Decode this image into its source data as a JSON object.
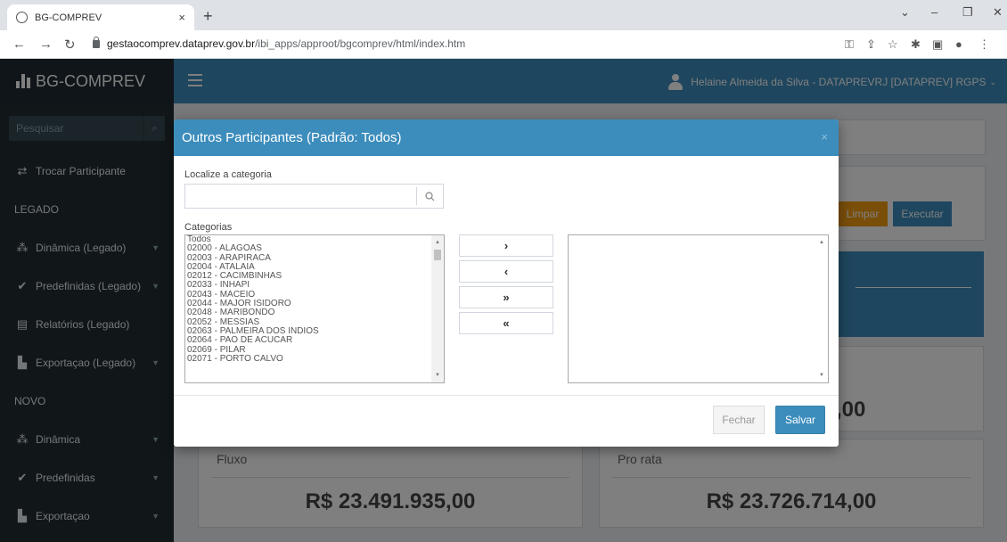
{
  "browser": {
    "tab_title": "BG-COMPREV",
    "tab_close": "×",
    "new_tab": "+",
    "url_host": "gestaocomprev.dataprev.gov.br",
    "url_path": "/ibi_apps/approot/bgcomprev/html/index.htm"
  },
  "app": {
    "brand": "BG-COMPREV",
    "user": "Helaine Almeida da Silva - DATAPREVRJ [DATAPREV] RGPS",
    "search_placeholder": "Pesquisar"
  },
  "sidebar": {
    "items": [
      {
        "label": "Trocar Participante",
        "icon": "exchange-icon"
      },
      {
        "label": "LEGADO",
        "header": true
      },
      {
        "label": "Dinâmica (Legado)",
        "icon": "cubes-icon",
        "chevron": true
      },
      {
        "label": "Predefinidas (Legado)",
        "icon": "check-icon",
        "chevron": true
      },
      {
        "label": "Relatórios (Legado)",
        "icon": "document-icon"
      },
      {
        "label": "Exportaçao (Legado)",
        "icon": "file-icon",
        "chevron": true
      },
      {
        "label": "NOVO",
        "header": true
      },
      {
        "label": "Dinâmica",
        "icon": "cubes-icon",
        "chevron": true
      },
      {
        "label": "Predefinidas",
        "icon": "check-icon",
        "chevron": true
      },
      {
        "label": "Exportaçao",
        "icon": "file-icon",
        "chevron": true
      }
    ]
  },
  "background": {
    "clear_button": "Limpar",
    "execute_button": "Executar",
    "partial_value": ",00",
    "cards": [
      {
        "label": "Fluxo",
        "value": "R$ 23.491.935,00"
      },
      {
        "label": "Pro rata",
        "value": "R$ 23.726.714,00"
      }
    ]
  },
  "modal": {
    "title": "Outros Participantes (Padrão: Todos)",
    "close": "×",
    "locate_label": "Localize a categoria",
    "locate_value": "",
    "categories_label": "Categorias",
    "categories": [
      "Todos",
      "02000 - ALAGOAS",
      "02003 - ARAPIRACA",
      "02004 - ATALAIA",
      "02012 - CACIMBINHAS",
      "02033 - INHAPI",
      "02043 - MACEIO",
      "02044 - MAJOR ISIDORO",
      "02048 - MARIBONDO",
      "02052 - MESSIAS",
      "02063 - PALMEIRA DOS INDIOS",
      "02064 - PAO DE ACUCAR",
      "02069 - PILAR",
      "02071 - PORTO CALVO"
    ],
    "move_buttons": [
      {
        "glyph": "›",
        "name": "move-right-button"
      },
      {
        "glyph": "‹",
        "name": "move-left-button"
      },
      {
        "glyph": "»",
        "name": "move-all-right-button"
      },
      {
        "glyph": "«",
        "name": "move-all-left-button"
      }
    ],
    "close_button": "Fechar",
    "save_button": "Salvar"
  },
  "colors": {
    "primary": "#3c8dbc",
    "sidebar": "#222d32",
    "warning": "#f39c12"
  }
}
